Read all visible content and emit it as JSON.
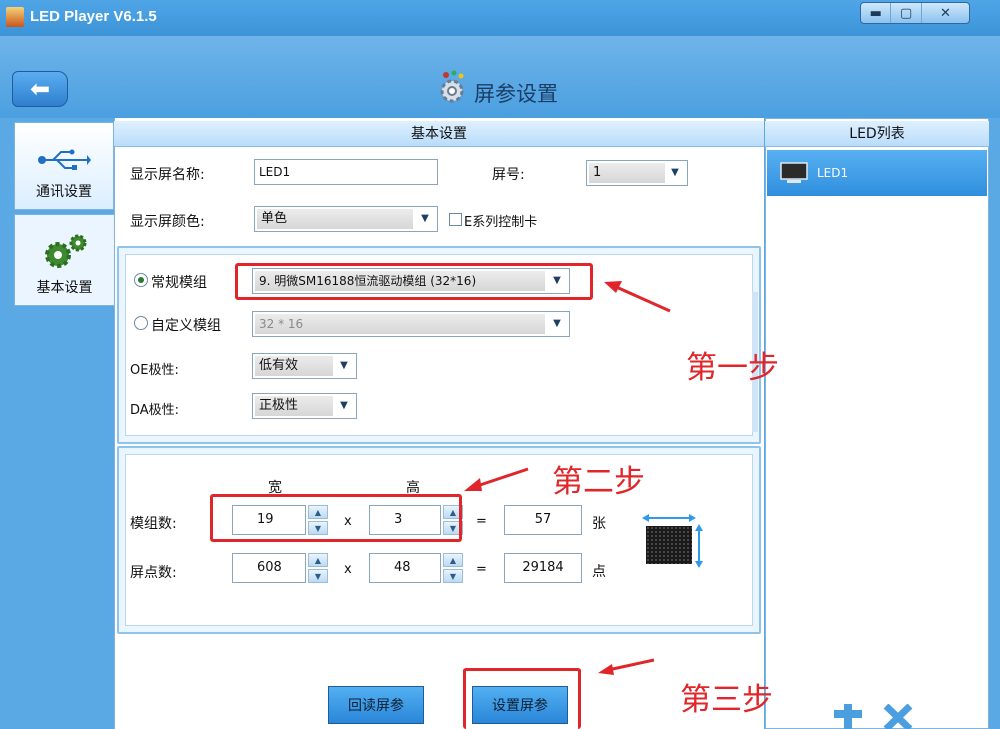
{
  "window": {
    "title": "LED Player V6.1.5",
    "min_icon": "▬",
    "max_icon": "▢",
    "close_icon": "✕"
  },
  "header": {
    "page_title": "屏参设置",
    "back_icon": "back-arrow-icon"
  },
  "nav": [
    {
      "label": "通讯设置",
      "icon": "usb-icon"
    },
    {
      "label": "基本设置",
      "icon": "gears-icon"
    }
  ],
  "main": {
    "heading": "基本设置",
    "screen_name_label": "显示屏名称:",
    "screen_name_value": "LED1",
    "screen_no_label": "屏号:",
    "screen_no_value": "1",
    "screen_color_label": "显示屏颜色:",
    "screen_color_value": "单色",
    "e_series_label": "E系列控制卡",
    "module": {
      "normal_label": "常规模组",
      "normal_value": "9. 明微SM16188恒流驱动模组 (32*16)",
      "custom_label": "自定义模组",
      "custom_value": "32 * 16",
      "oe_label": "OE极性:",
      "oe_value": "低有效",
      "da_label": "DA极性:",
      "da_value": "正极性"
    },
    "size": {
      "width_header": "宽",
      "height_header": "高",
      "module_count_label": "模组数:",
      "module_w": "19",
      "module_h": "3",
      "module_total": "57",
      "module_unit": "张",
      "pixel_count_label": "屏点数:",
      "pixel_w": "608",
      "pixel_h": "48",
      "pixel_total": "29184",
      "pixel_unit": "点",
      "times": "x",
      "equals": "="
    },
    "read_button": "回读屏参",
    "set_button": "设置屏参"
  },
  "right": {
    "heading": "LED列表",
    "items": [
      "LED1"
    ],
    "add_icon": "plus-icon",
    "delete_icon": "x-icon"
  },
  "annotations": {
    "step1": "第一步",
    "step2": "第二步",
    "step3": "第三步"
  },
  "colors": {
    "accent": "#3c94d8",
    "annotation": "#e0262a"
  }
}
